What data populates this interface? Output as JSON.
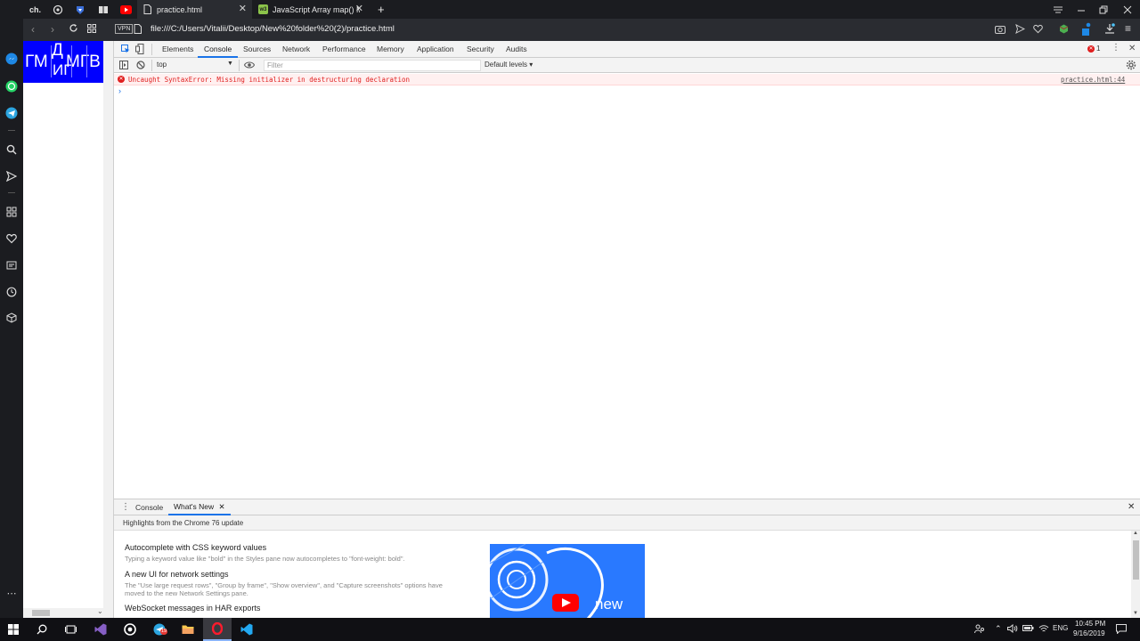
{
  "browser": {
    "pinned_tab_label": "ch.",
    "tabs": [
      {
        "title": "practice.html",
        "active": true
      },
      {
        "title": "JavaScript Array map() Met"
      }
    ],
    "new_tab_symbol": "+",
    "url": "file:///C:/Users/Vitalii/Desktop/New%20folder%20(2)/practice.html",
    "vpn_label": "VPN",
    "accent": "#1a73e8"
  },
  "page": {
    "blue_box_text": [
      "ГМ",
      "Д",
      "ИГ",
      "МГВ"
    ],
    "blue_box_color": "#0000ff"
  },
  "devtools": {
    "tabs": [
      "Elements",
      "Console",
      "Sources",
      "Network",
      "Performance",
      "Memory",
      "Application",
      "Security",
      "Audits"
    ],
    "active_tab": "Console",
    "error_count": "1",
    "context": "top",
    "filter_placeholder": "Filter",
    "levels": "Default levels",
    "error_message": "Uncaught SyntaxError: Missing initializer in destructuring declaration",
    "error_source": "practice.html:44",
    "prompt": "›",
    "drawer": {
      "tabs": [
        "Console",
        "What's New"
      ],
      "active_tab": "What's New",
      "subtitle": "Highlights from the Chrome 76 update",
      "items": [
        {
          "title": "Autocomplete with CSS keyword values",
          "desc": "Typing a keyword value like \"bold\" in the Styles pane now autocompletes to \"font-weight: bold\"."
        },
        {
          "title": "A new UI for network settings",
          "desc": "The \"Use large request rows\", \"Group by frame\", \"Show overview\", and \"Capture screenshots\" options have moved to the new Network Settings pane."
        },
        {
          "title": "WebSocket messages in HAR exports",
          "desc": ""
        }
      ],
      "promo_text": "new"
    }
  },
  "taskbar": {
    "language": "ENG",
    "time": "10:45 PM",
    "date": "9/16/2019",
    "badge": "19"
  }
}
